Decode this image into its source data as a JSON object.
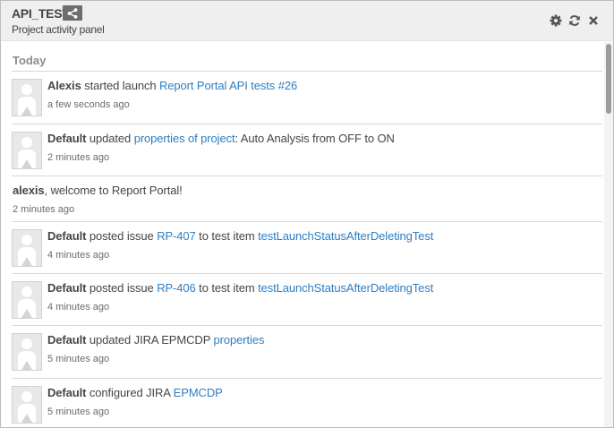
{
  "header": {
    "title": "API_TESTS",
    "subtitle": "Project activity panel",
    "icons": [
      "share-icon",
      "gear-icon",
      "refresh-icon",
      "close-icon"
    ]
  },
  "activity": {
    "day_label": "Today",
    "items": [
      {
        "user": "Alexis",
        "action": " started launch ",
        "link": "Report Portal API tests #26",
        "time": "a few seconds ago"
      },
      {
        "user": "Default",
        "action": " updated ",
        "link": "properties of project",
        "suffix": ": Auto Analysis from OFF to ON",
        "time": "2 minutes ago"
      },
      {
        "user": "alexis",
        "suffix": ", welcome to Report Portal!",
        "time": "2 minutes ago"
      },
      {
        "user": "Default",
        "action": " posted issue ",
        "link": "RP-407",
        "mid": " to test item ",
        "link2": "testLaunchStatusAfterDeletingTest",
        "time": "4 minutes ago"
      },
      {
        "user": "Default",
        "action": " posted issue ",
        "link": "RP-406",
        "mid": " to test item ",
        "link2": "testLaunchStatusAfterDeletingTest",
        "time": "4 minutes ago"
      },
      {
        "user": "Default",
        "action": " updated JIRA EPMCDP ",
        "link": "properties",
        "time": "5 minutes ago"
      },
      {
        "user": "Default",
        "action": " configured JIRA ",
        "link": "EPMCDP",
        "time": "5 minutes ago"
      }
    ]
  },
  "colors": {
    "link": "#2f7ec1",
    "header_bg": "#efefef",
    "share_bg": "#6d6d6d"
  }
}
